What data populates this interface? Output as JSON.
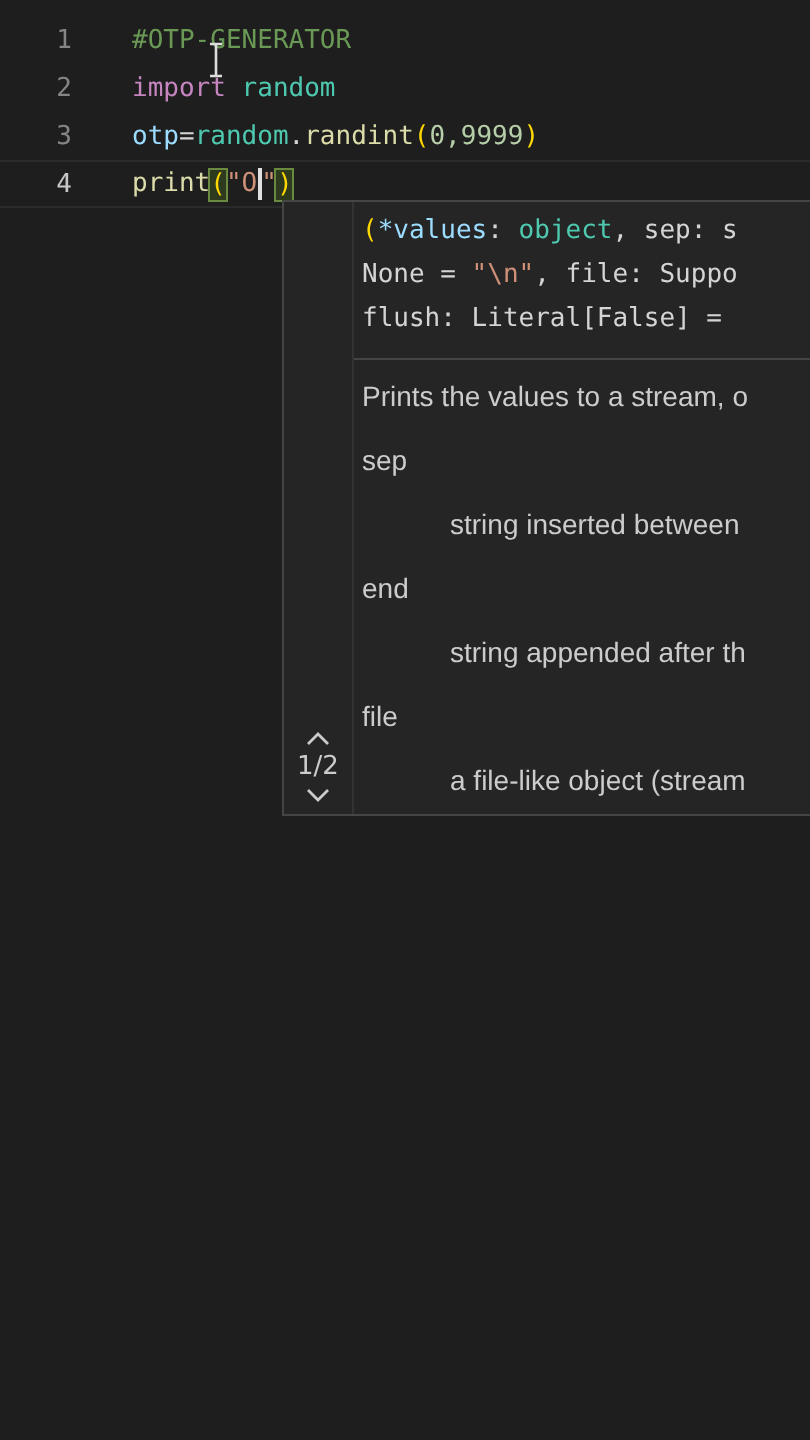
{
  "editor": {
    "lines": [
      {
        "number": "1",
        "current": false,
        "tokens": [
          {
            "kind": "comment",
            "text": "#OTP-GENERATOR"
          }
        ]
      },
      {
        "number": "2",
        "current": false,
        "tokens": [
          {
            "kind": "keyword",
            "text": "import"
          },
          {
            "kind": "module",
            "text": " random"
          }
        ]
      },
      {
        "number": "3",
        "current": false,
        "tokens": [
          {
            "kind": "variable",
            "text": "otp"
          },
          {
            "kind": "plain",
            "text": "="
          },
          {
            "kind": "module",
            "text": "random"
          },
          {
            "kind": "plain",
            "text": "."
          },
          {
            "kind": "function",
            "text": "randint"
          },
          {
            "kind": "bracket",
            "text": "("
          },
          {
            "kind": "number",
            "text": "0,9999"
          },
          {
            "kind": "bracket",
            "text": ")"
          }
        ]
      },
      {
        "number": "4",
        "current": true,
        "tokens": [
          {
            "kind": "function",
            "text": "print"
          },
          {
            "kind": "bracket",
            "text": "(",
            "matched": true
          },
          {
            "kind": "string",
            "text": "\"O",
            "caret": true
          },
          {
            "kind": "string",
            "text": "\""
          },
          {
            "kind": "bracket",
            "text": ")",
            "matched": true
          }
        ]
      }
    ]
  },
  "hover": {
    "signature": [
      [
        {
          "kind": "bracket",
          "text": "("
        },
        {
          "kind": "param",
          "text": "*values"
        },
        {
          "kind": "plain",
          "text": ": "
        },
        {
          "kind": "type",
          "text": "object"
        },
        {
          "kind": "plain",
          "text": ", sep: s"
        }
      ],
      [
        {
          "kind": "plain",
          "text": "None = "
        },
        {
          "kind": "string",
          "text": "\"\\n\""
        },
        {
          "kind": "plain",
          "text": ", file: Suppo"
        }
      ],
      [
        {
          "kind": "plain",
          "text": "flush: Literal[False] ="
        }
      ]
    ],
    "doc": [
      {
        "kind": "text",
        "text": "Prints the values to a stream, o"
      },
      {
        "kind": "term",
        "text": "sep"
      },
      {
        "kind": "desc",
        "text": "string inserted between"
      },
      {
        "kind": "term",
        "text": "end"
      },
      {
        "kind": "desc",
        "text": "string appended after th"
      },
      {
        "kind": "term",
        "text": "file"
      },
      {
        "kind": "desc",
        "text": "a file-like object (stream"
      }
    ],
    "pager": "1/2"
  }
}
